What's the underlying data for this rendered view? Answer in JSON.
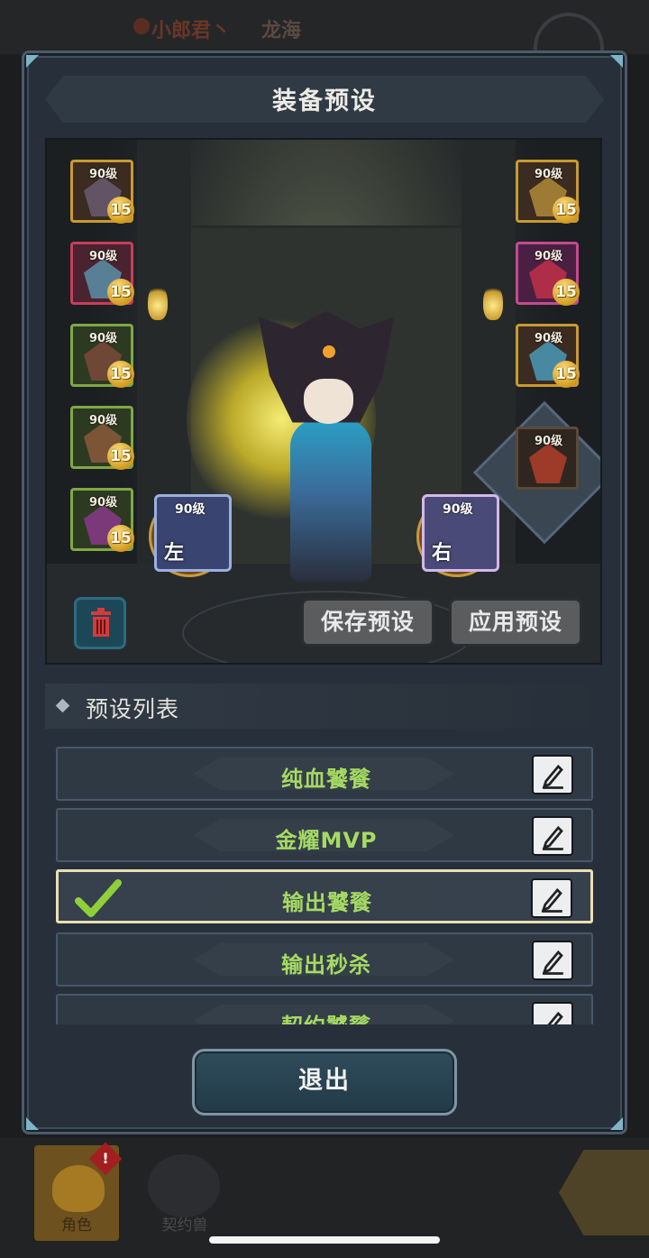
{
  "background": {
    "player_name": "小郎君丶",
    "server_name": "龙海"
  },
  "dialog": {
    "title": "装备预设"
  },
  "equipment": {
    "left_slots": [
      {
        "level": "90级",
        "enhance": "15",
        "rarity": "orange"
      },
      {
        "level": "90级",
        "enhance": "15",
        "rarity": "red"
      },
      {
        "level": "90级",
        "enhance": "15",
        "rarity": "green"
      },
      {
        "level": "90级",
        "enhance": "15",
        "rarity": "green"
      },
      {
        "level": "90级",
        "enhance": "15",
        "rarity": "green"
      }
    ],
    "right_slots": [
      {
        "level": "90级",
        "enhance": "15",
        "rarity": "orange"
      },
      {
        "level": "90级",
        "enhance": "15",
        "rarity": "pink"
      },
      {
        "level": "90级",
        "enhance": "15",
        "rarity": "orange"
      }
    ],
    "special_slot": {
      "level": "90级"
    },
    "weapon_left": {
      "level": "90级",
      "side": "左",
      "locked": true
    },
    "weapon_right": {
      "level": "90级",
      "side": "右",
      "locked": true
    }
  },
  "actions": {
    "save_preset": "保存预设",
    "apply_preset": "应用预设",
    "delete_icon": "trash-icon"
  },
  "preset_list": {
    "header": "预设列表",
    "items": [
      {
        "label": "纯血饕餮",
        "selected": false
      },
      {
        "label": "金耀MVP",
        "selected": false
      },
      {
        "label": "输出饕餮",
        "selected": true
      },
      {
        "label": "输出秒杀",
        "selected": false
      },
      {
        "label": "契约饕餮",
        "selected": false
      }
    ]
  },
  "exit_button": "退出",
  "bottom_nav": {
    "tabs": [
      {
        "label": "角色",
        "active": true,
        "alert": "!"
      },
      {
        "label": "契约兽",
        "active": false
      }
    ]
  },
  "colors": {
    "accent_green": "#a6da63",
    "panel": "#27303a",
    "enhance_gold": "#d19a1e"
  }
}
